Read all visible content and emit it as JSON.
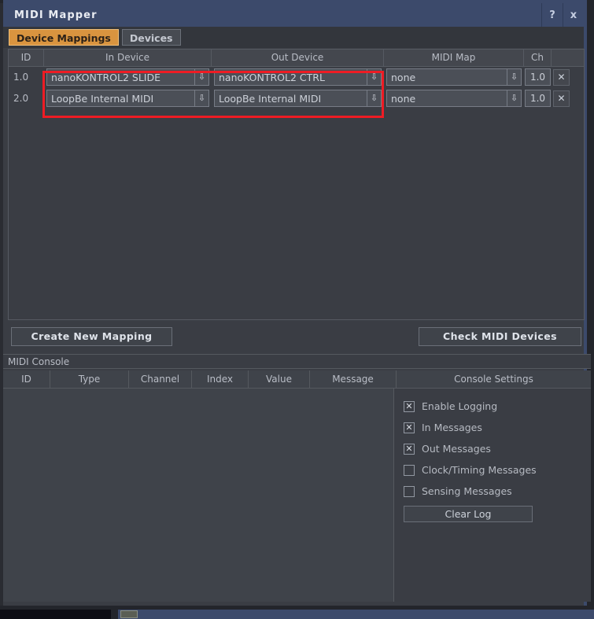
{
  "window": {
    "title": "MIDI Mapper",
    "help_button": "?",
    "close_button": "x"
  },
  "tabs": [
    {
      "label": "Device Mappings",
      "active": true
    },
    {
      "label": "Devices",
      "active": false
    }
  ],
  "mappings_table": {
    "columns": [
      "ID",
      "In Device",
      "Out Device",
      "MIDI Map",
      "Ch",
      ""
    ],
    "rows": [
      {
        "id": "1.0",
        "in_device": "nanoKONTROL2 SLIDE",
        "out_device": "nanoKONTROL2 CTRL",
        "midi_map": "none",
        "channel": "1.0",
        "delete": "✕"
      },
      {
        "id": "2.0",
        "in_device": "LoopBe Internal MIDI",
        "out_device": "LoopBe Internal MIDI",
        "midi_map": "none",
        "channel": "1.0",
        "delete": "✕"
      }
    ],
    "dropdown_arrow": "⇩"
  },
  "buttons": {
    "create_new_mapping": "Create New Mapping",
    "check_midi_devices": "Check MIDI Devices"
  },
  "console": {
    "section_title": "MIDI Console",
    "columns": [
      "ID",
      "Type",
      "Channel",
      "Index",
      "Value",
      "Message",
      "Console Settings"
    ],
    "rows": []
  },
  "console_settings": {
    "title": "Console Settings",
    "checkboxes": [
      {
        "label": "Enable Logging",
        "checked": true,
        "mark": "✕"
      },
      {
        "label": "In Messages",
        "checked": true,
        "mark": "✕"
      },
      {
        "label": "Out Messages",
        "checked": true,
        "mark": "✕"
      },
      {
        "label": "Clock/Timing Messages",
        "checked": false,
        "mark": ""
      },
      {
        "label": "Sensing Messages",
        "checked": false,
        "mark": ""
      }
    ],
    "clear_log_button": "Clear Log"
  },
  "colors": {
    "titlebar": "#3c4a6b",
    "active_tab": "#d9943f",
    "panel_bg": "#3a3d44",
    "highlight_box": "#ee1c24",
    "text": "#b8bcc4"
  }
}
